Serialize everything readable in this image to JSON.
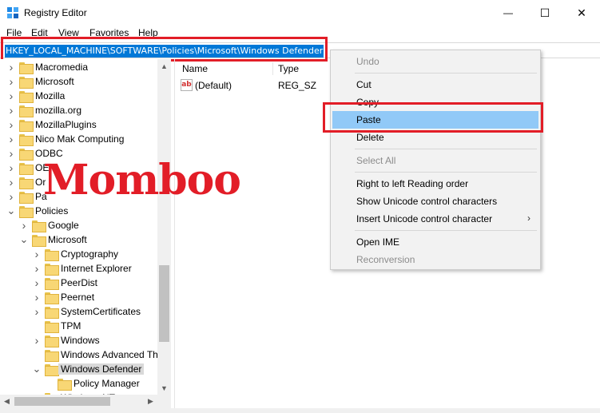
{
  "window": {
    "title": "Registry Editor",
    "minimize_glyph": "—",
    "maximize_glyph": "☐",
    "close_glyph": "✕",
    "icon": "registry-icon"
  },
  "menu": [
    "File",
    "Edit",
    "View",
    "Favorites",
    "Help"
  ],
  "address": {
    "path": "HKEY_LOCAL_MACHINE\\SOFTWARE\\Policies\\Microsoft\\Windows Defender"
  },
  "tree": {
    "items": [
      {
        "label": "Macromedia",
        "level": 1,
        "expander": "collapsed"
      },
      {
        "label": "Microsoft",
        "level": 1,
        "expander": "collapsed"
      },
      {
        "label": "Mozilla",
        "level": 1,
        "expander": "collapsed"
      },
      {
        "label": "mozilla.org",
        "level": 1,
        "expander": "collapsed"
      },
      {
        "label": "MozillaPlugins",
        "level": 1,
        "expander": "collapsed"
      },
      {
        "label": "Nico Mak Computing",
        "level": 1,
        "expander": "collapsed"
      },
      {
        "label": "ODBC",
        "level": 1,
        "expander": "collapsed"
      },
      {
        "label": "OEM",
        "level": 1,
        "expander": "collapsed"
      },
      {
        "label": "Or",
        "level": 1,
        "expander": "collapsed"
      },
      {
        "label": "Pa",
        "level": 1,
        "expander": "collapsed"
      },
      {
        "label": "Policies",
        "level": 1,
        "expander": "expanded"
      },
      {
        "label": "Google",
        "level": 2,
        "expander": "collapsed"
      },
      {
        "label": "Microsoft",
        "level": 2,
        "expander": "expanded"
      },
      {
        "label": "Cryptography",
        "level": 3,
        "expander": "collapsed"
      },
      {
        "label": "Internet Explorer",
        "level": 3,
        "expander": "collapsed"
      },
      {
        "label": "PeerDist",
        "level": 3,
        "expander": "collapsed"
      },
      {
        "label": "Peernet",
        "level": 3,
        "expander": "collapsed"
      },
      {
        "label": "SystemCertificates",
        "level": 3,
        "expander": "collapsed"
      },
      {
        "label": "TPM",
        "level": 3,
        "expander": "none"
      },
      {
        "label": "Windows",
        "level": 3,
        "expander": "collapsed"
      },
      {
        "label": "Windows Advanced Th",
        "level": 3,
        "expander": "none"
      },
      {
        "label": "Windows Defender",
        "level": 3,
        "expander": "expanded",
        "selected": true
      },
      {
        "label": "Policy Manager",
        "level": 4,
        "expander": "none"
      },
      {
        "label": "Windows NT",
        "level": 3,
        "expander": "collapsed"
      }
    ]
  },
  "list": {
    "columns": [
      "Name",
      "Type"
    ],
    "rows": [
      {
        "name": "(Default)",
        "type": "REG_SZ",
        "icon": "string-value-icon"
      }
    ]
  },
  "watermark": "Momboo",
  "context_menu": {
    "items": [
      {
        "label": "Undo",
        "disabled": true
      },
      {
        "separator": true
      },
      {
        "label": "Cut"
      },
      {
        "label": "Copy"
      },
      {
        "label": "Paste",
        "hovered": true
      },
      {
        "label": "Delete"
      },
      {
        "separator": true
      },
      {
        "label": "Select All",
        "disabled": true
      },
      {
        "separator": true
      },
      {
        "label": "Right to left Reading order"
      },
      {
        "label": "Show Unicode control characters"
      },
      {
        "label": "Insert Unicode control character",
        "submenu": true
      },
      {
        "separator": true
      },
      {
        "label": "Open IME"
      },
      {
        "label": "Reconversion",
        "disabled": true
      }
    ]
  },
  "colors": {
    "highlight_box": "#e21d27",
    "selection_blue": "#0078d7",
    "menu_hover": "#91c9f7"
  }
}
